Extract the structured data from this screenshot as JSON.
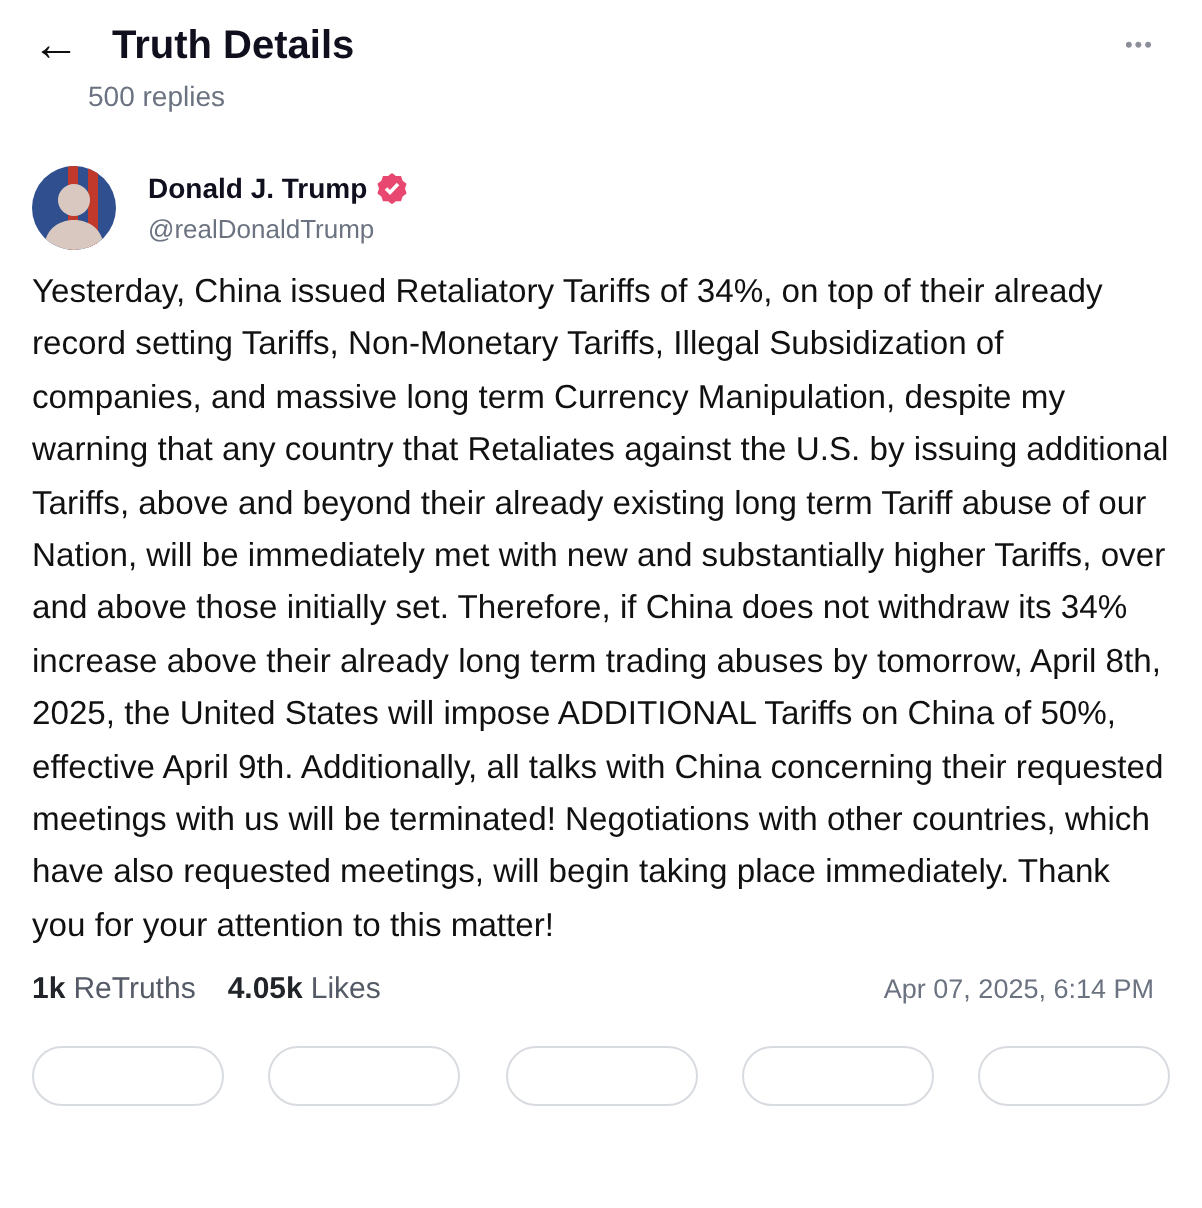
{
  "header": {
    "back": "←",
    "title": "Truth Details",
    "subtitle": "500 replies",
    "menu": "•••"
  },
  "post": {
    "author": {
      "name": "Donald J. Trump",
      "verified": true,
      "handle": "@realDonaldTrump"
    },
    "text": "Yesterday, China issued Retaliatory Tariffs of 34%, on top of their already record setting Tariffs, Non-Monetary Tariffs, Illegal Subsidization of companies, and massive long term Currency Manipulation, despite my warning that any country that Retaliates against the U.S. by issuing additional Tariffs, above and beyond their already existing long term Tariff abuse of our Nation, will be immediately met with new and substantially higher Tariffs, over and above those initially set. Therefore, if China does not withdraw its 34% increase above their already long term trading abuses by tomorrow, April 8th, 2025, the United States will impose ADDITIONAL Tariffs on China of 50%, effective April 9th. Additionally, all talks with China concerning their requested meetings with us will be terminated! Negotiations with other countries, which have also requested meetings, will begin taking place immediately. Thank you for your attention to this matter!",
    "stats": [
      {
        "count": "1k",
        "label": "ReTruths"
      },
      {
        "count": "4.05k",
        "label": "Likes"
      }
    ],
    "timestamp": "Apr 07, 2025, 6:14 PM"
  }
}
